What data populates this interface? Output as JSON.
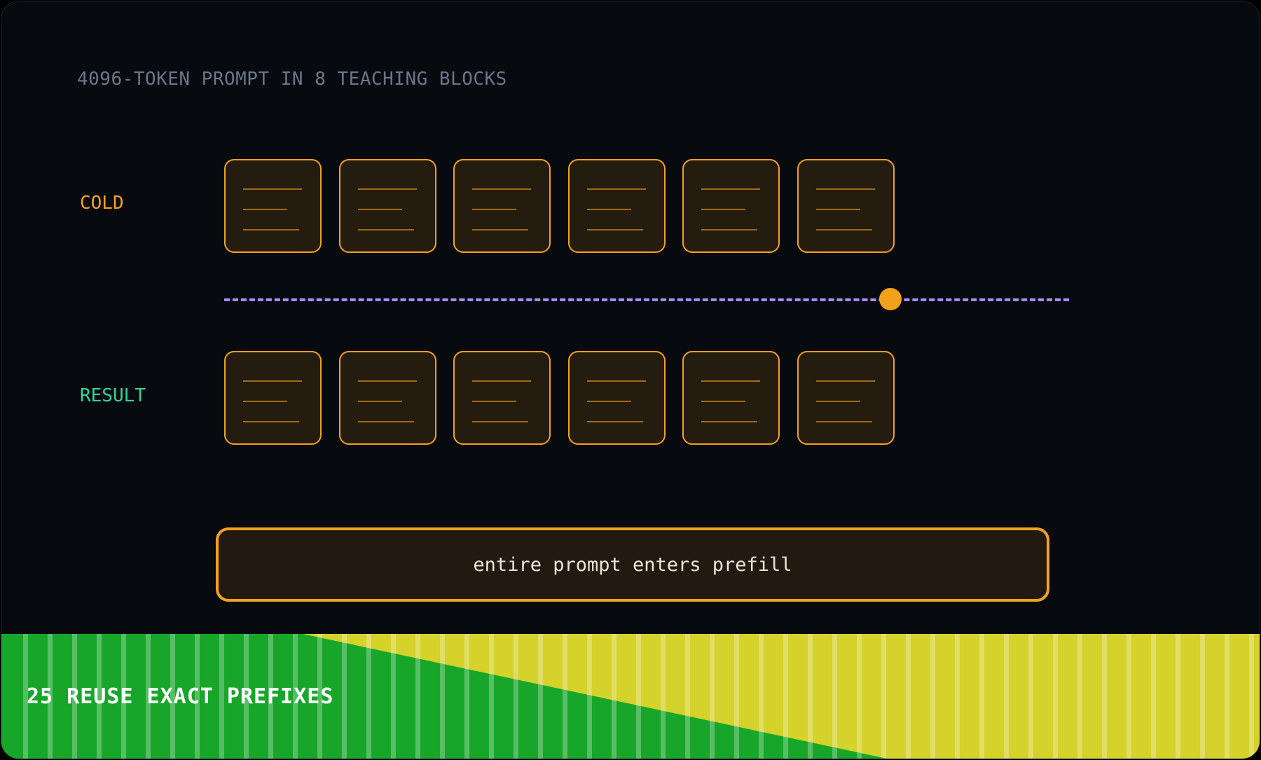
{
  "title": "4096-TOKEN PROMPT IN 8 TEACHING BLOCKS",
  "rows": {
    "cold_label": "COLD",
    "result_label": "RESULT"
  },
  "blocks_per_row": 6,
  "result_message": "entire prompt enters prefill",
  "banner": {
    "text": "25 REUSE EXACT PREFIXES",
    "primary_color": "#18a62a",
    "secondary_color": "#d4d22b"
  },
  "colors": {
    "background": "#070a0f",
    "accent": "#f3a11c",
    "cold_label": "#f3a11c",
    "result_label": "#34d399",
    "timeline": "#a78bfa",
    "title": "#6b7689"
  },
  "icons": {
    "block_icon": "document-lines-icon",
    "marker_icon": "position-dot-icon"
  }
}
